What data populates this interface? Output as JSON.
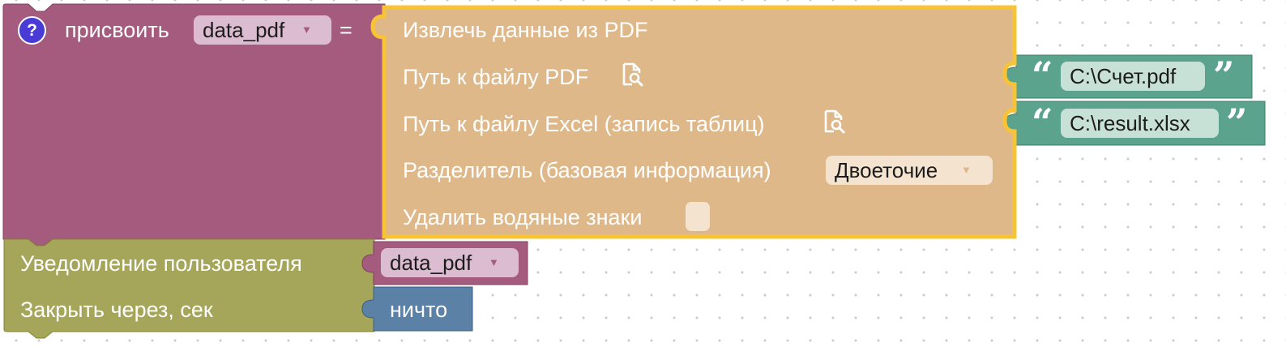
{
  "assign_block": {
    "help_glyph": "?",
    "label": "присвоить",
    "variable": "data_pdf",
    "equals": "=",
    "color": "#a45b7e"
  },
  "extract_block": {
    "title": "Извлечь данные из PDF",
    "pdf_path_label": "Путь к файлу PDF",
    "excel_path_label": "Путь к файлу Excel (запись таблиц)",
    "separator_label": "Разделитель (базовая информация)",
    "separator_value": "Двоеточие",
    "remove_watermarks_label": "Удалить водяные знаки",
    "remove_watermarks_checked": false,
    "file_icon": "file-search-icon",
    "color": "#dfb88a",
    "selected_border_color": "#f8c435"
  },
  "pdf_string": {
    "open_quote": "“",
    "value": "C:\\Счет.pdf",
    "close_quote": "”",
    "color": "#5ba38c"
  },
  "excel_string": {
    "open_quote": "“",
    "value": "C:\\result.xlsx",
    "close_quote": "”",
    "color": "#5ba38c"
  },
  "notify_block": {
    "label": "Уведомление пользователя",
    "close_label": "Закрыть через, сек",
    "color": "#a5a659"
  },
  "notify_variable": {
    "value": "data_pdf",
    "color": "#a45b7e"
  },
  "null_block": {
    "label": "ничто",
    "color": "#5b81a6"
  },
  "dropdown_arrow": "▼"
}
